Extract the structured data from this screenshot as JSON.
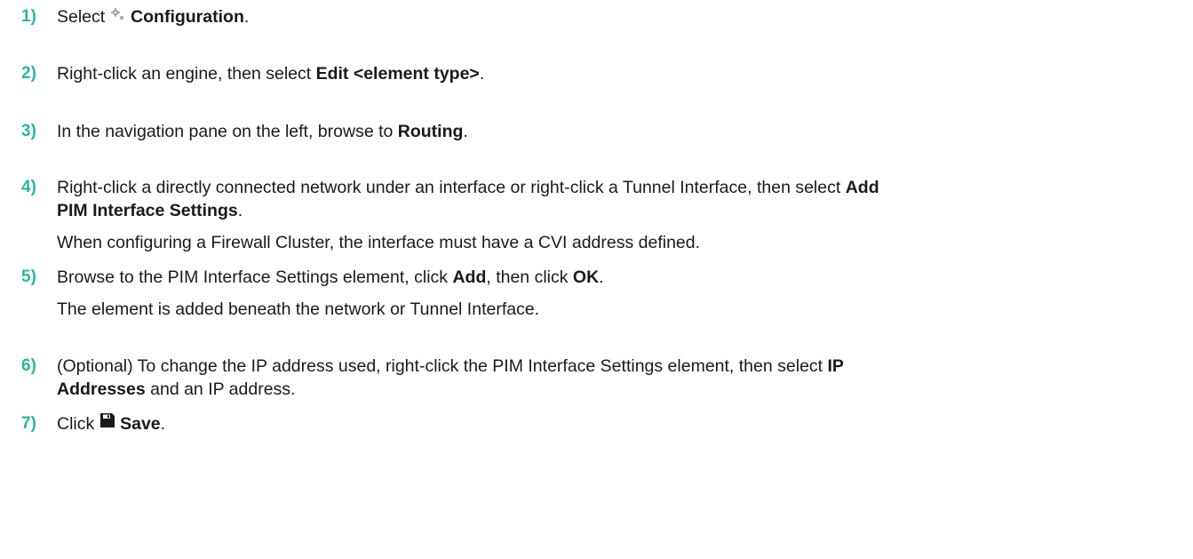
{
  "steps": [
    {
      "num": "1)",
      "text_before": "Select ",
      "icon": "configuration-gear-icon",
      "bold": "Configuration",
      "text_after": "."
    },
    {
      "num": "2)",
      "text_before": "Right-click an engine, then select ",
      "bold": "Edit <element type>",
      "text_after": "."
    },
    {
      "num": "3)",
      "text_before": "In the navigation pane on the left, browse to ",
      "bold": "Routing",
      "text_after": "."
    },
    {
      "num": "4)",
      "text_before": "Right-click a directly connected network under an interface or right-click a Tunnel Interface, then select ",
      "bold_line1": "Add",
      "bold_line2": "PIM Interface Settings",
      "text_after": ".",
      "note": "When configuring a Firewall Cluster, the interface must have a CVI address defined."
    },
    {
      "num": "5)",
      "text_before": "Browse to the PIM Interface Settings element, click ",
      "bold1": "Add",
      "text_mid": ", then click ",
      "bold2": "OK",
      "text_after": ".",
      "note": "The element is added beneath the network or Tunnel Interface."
    },
    {
      "num": "6)",
      "text_before": "(Optional) To change the IP address used, right-click the PIM Interface Settings element, then select ",
      "bold_line1": "IP",
      "bold_line2": "Addresses",
      "text_after": " and an IP address."
    },
    {
      "num": "7)",
      "text_before": "Click ",
      "icon": "save-icon",
      "bold": "Save",
      "text_after": "."
    }
  ]
}
